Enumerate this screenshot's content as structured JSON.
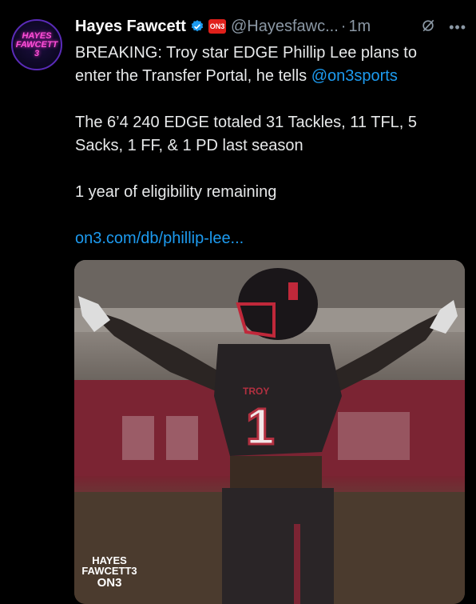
{
  "avatar": {
    "lines": [
      "HAYES",
      "FAWCETT",
      "3"
    ]
  },
  "author": {
    "name": "Hayes Fawcett",
    "badge": "ON3",
    "handle": "@Hayesfawc...",
    "separator": "·",
    "time": "1m"
  },
  "more_icon": "more-icon",
  "tweet": {
    "line1": "BREAKING: Troy star EDGE Phillip Lee plans to",
    "line2_prefix": "enter the Transfer Portal, he tells ",
    "mention": "@on3sports",
    "stats1": "The 6’4 240 EDGE totaled 31 Tackles, 11 TFL, 5",
    "stats2": "Sacks, 1 FF, & 1 PD last season",
    "eligibility": "1 year of eligibility remaining",
    "link": "on3.com/db/phillip-lee..."
  },
  "media": {
    "jersey_number": "1",
    "jersey_wordmark": "TROY",
    "watermark": [
      "HAYES",
      "FAWCETT3",
      "ON3"
    ]
  },
  "colors": {
    "link": "#1d9bf0",
    "verified": "#1d9bf0",
    "muted": "#8b98a5"
  }
}
